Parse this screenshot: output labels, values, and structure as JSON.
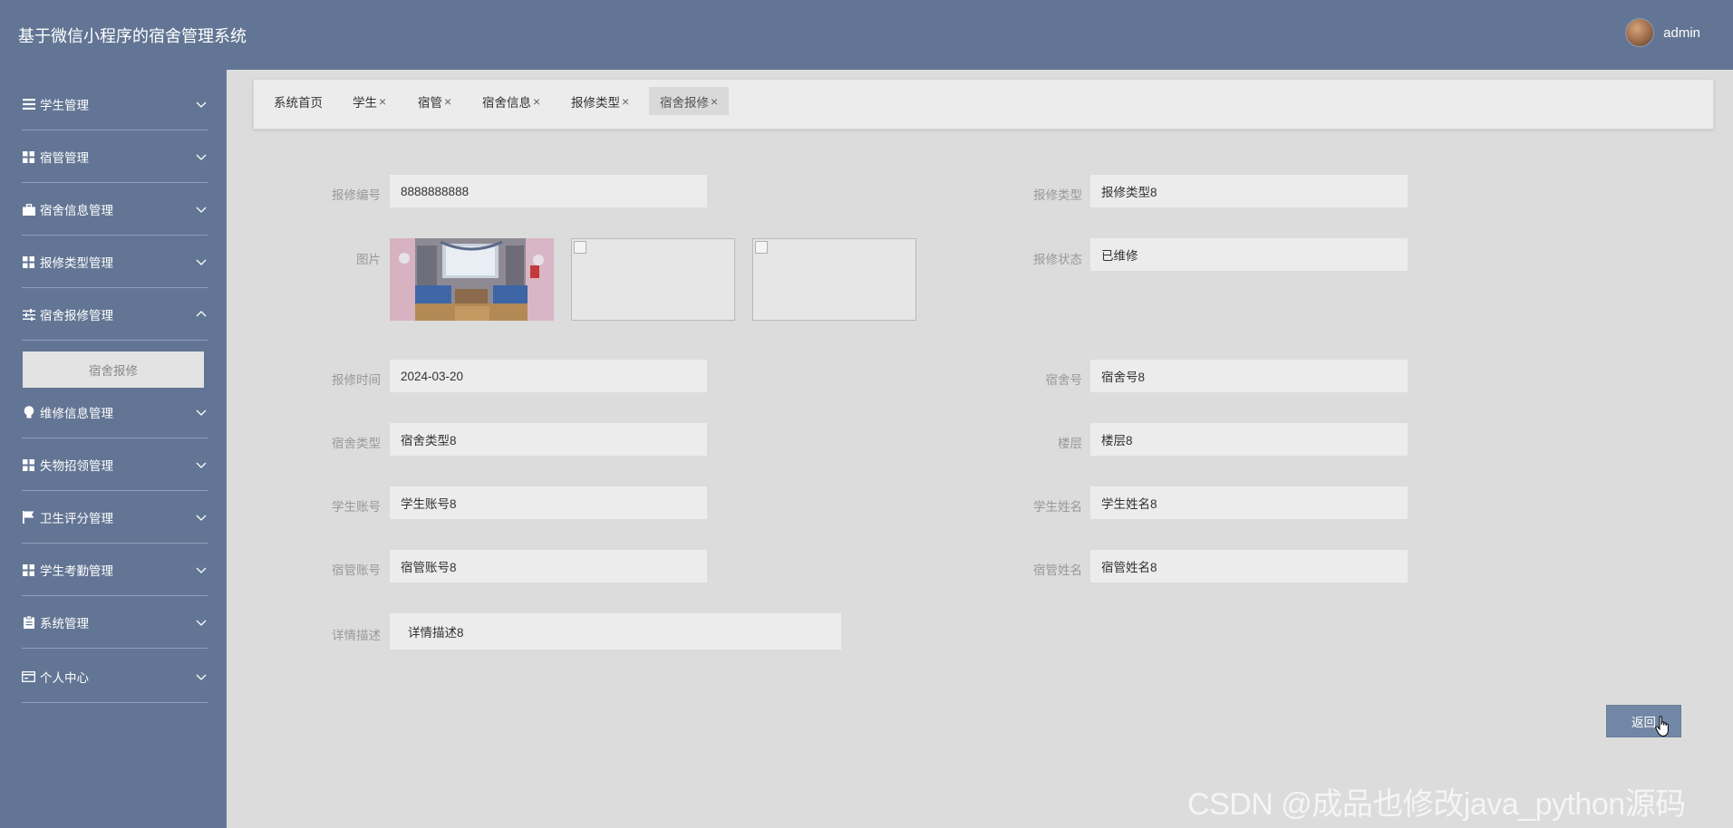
{
  "header": {
    "title": "基于微信小程序的宿舍管理系统",
    "user_name": "admin"
  },
  "sidebar": {
    "items": [
      {
        "label": "学生管理",
        "icon": "list-icon"
      },
      {
        "label": "宿管管理",
        "icon": "grid-icon"
      },
      {
        "label": "宿舍信息管理",
        "icon": "briefcase-icon"
      },
      {
        "label": "报修类型管理",
        "icon": "grid-icon"
      },
      {
        "label": "宿舍报修管理",
        "icon": "sliders-icon",
        "expanded": true
      },
      {
        "label": "维修信息管理",
        "icon": "bulb-icon"
      },
      {
        "label": "失物招领管理",
        "icon": "grid-icon"
      },
      {
        "label": "卫生评分管理",
        "icon": "flag-icon"
      },
      {
        "label": "学生考勤管理",
        "icon": "grid-icon"
      },
      {
        "label": "系统管理",
        "icon": "clipboard-icon"
      },
      {
        "label": "个人中心",
        "icon": "card-icon"
      }
    ],
    "submenu": {
      "label": "宿舍报修"
    }
  },
  "tabs": [
    {
      "label": "系统首页",
      "closable": false
    },
    {
      "label": "学生",
      "closable": true
    },
    {
      "label": "宿管",
      "closable": true
    },
    {
      "label": "宿舍信息",
      "closable": true
    },
    {
      "label": "报修类型",
      "closable": true
    },
    {
      "label": "宿舍报修",
      "closable": true,
      "active": true
    }
  ],
  "tab_close_glyph": "×",
  "form": {
    "repair_no": {
      "label": "报修编号",
      "value": "8888888888"
    },
    "repair_type": {
      "label": "报修类型",
      "value": "报修类型8"
    },
    "images": {
      "label": "图片",
      "count": 3
    },
    "repair_status": {
      "label": "报修状态",
      "value": "已维修"
    },
    "repair_time": {
      "label": "报修时间",
      "value": "2024-03-20"
    },
    "dorm_no": {
      "label": "宿舍号",
      "value": "宿舍号8"
    },
    "dorm_type": {
      "label": "宿舍类型",
      "value": "宿舍类型8"
    },
    "floor": {
      "label": "楼层",
      "value": "楼层8"
    },
    "student_account": {
      "label": "学生账号",
      "value": "学生账号8"
    },
    "student_name": {
      "label": "学生姓名",
      "value": "学生姓名8"
    },
    "manager_account": {
      "label": "宿管账号",
      "value": "宿管账号8"
    },
    "manager_name": {
      "label": "宿管姓名",
      "value": "宿管姓名8"
    },
    "description": {
      "label": "详情描述",
      "value": "详情描述8"
    }
  },
  "back_button": {
    "label": "返回"
  },
  "watermark": "CSDN @成品也修改java_python源码",
  "colors": {
    "header_bg": "#627594",
    "sidebar_bg": "#627594",
    "content_bg": "#dcdcdc",
    "field_bg": "#ececec",
    "button_bg": "#7287a5"
  }
}
